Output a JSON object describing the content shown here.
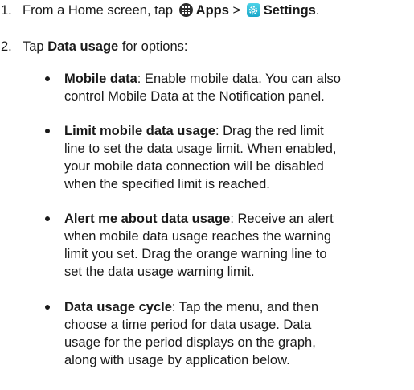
{
  "steps": [
    {
      "number": "1.",
      "prefix": "From a Home screen, tap",
      "apps_label": "Apps",
      "separator": ">",
      "settings_label": "Settings",
      "suffix": ".",
      "apps_icon": "apps-grid-icon",
      "settings_icon": "settings-gear-icon"
    },
    {
      "number": "2.",
      "prefix": "Tap",
      "bold": "Data usage",
      "suffix": "for options:"
    }
  ],
  "options": [
    {
      "title": "Mobile data",
      "lines": [
        ": Enable mobile data. You can also",
        "control Mobile Data at the Notification panel."
      ]
    },
    {
      "title": "Limit mobile data usage",
      "lines": [
        ": Drag the red limit",
        "line to set the data usage limit. When enabled,",
        "your mobile data connection will be disabled",
        "when the specified limit is reached."
      ]
    },
    {
      "title": "Alert me about data usage",
      "lines": [
        ": Receive an alert",
        "when mobile data usage reaches the warning",
        "limit you set. Drag the orange warning line to",
        "set the data usage warning limit."
      ]
    },
    {
      "title": "Data usage cycle",
      "lines": [
        ": Tap the menu, and then",
        "choose a time period for data usage. Data",
        "usage for the period displays on the graph,",
        "along with usage by application below."
      ]
    }
  ]
}
